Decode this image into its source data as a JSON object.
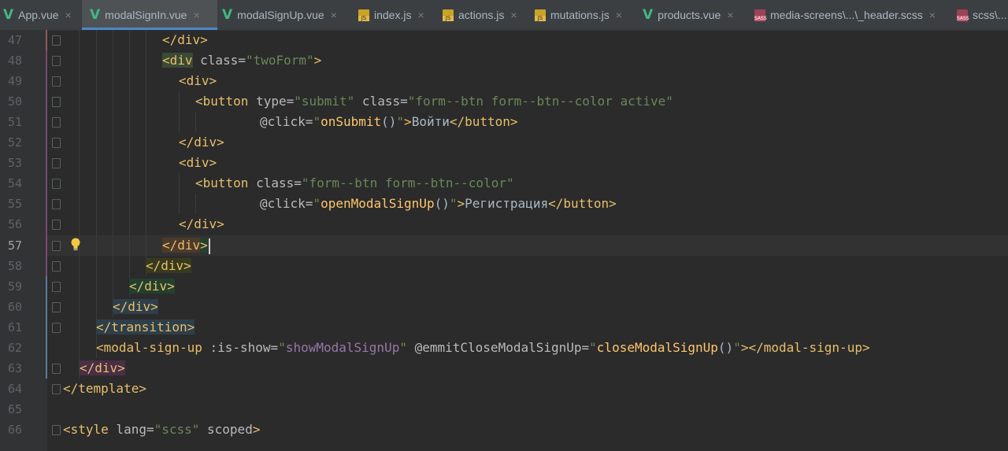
{
  "tabs": [
    {
      "label": "App.vue",
      "icon": "vue-icon",
      "active": false
    },
    {
      "label": "modalSignIn.vue",
      "icon": "vue-icon",
      "active": true
    },
    {
      "label": "modalSignUp.vue",
      "icon": "vue-icon",
      "active": false
    },
    {
      "label": "index.js",
      "icon": "js-file-icon",
      "active": false
    },
    {
      "label": "actions.js",
      "icon": "js-file-icon",
      "active": false
    },
    {
      "label": "mutations.js",
      "icon": "js-file-icon",
      "active": false
    },
    {
      "label": "products.vue",
      "icon": "vue-icon",
      "active": false
    },
    {
      "label": "media-screens\\...\\_header.scss",
      "icon": "sass-file-icon",
      "active": false
    },
    {
      "label": "scss\\...",
      "icon": "sass-file-icon",
      "active": false
    }
  ],
  "icon_badges": {
    "js": "JS",
    "sass": "SASS"
  },
  "close_glyph": "×",
  "current_line": "57",
  "line_numbers": [
    "47",
    "48",
    "49",
    "50",
    "51",
    "52",
    "53",
    "54",
    "55",
    "56",
    "57",
    "58",
    "59",
    "60",
    "61",
    "62",
    "63",
    "64",
    "65",
    "66"
  ],
  "code": {
    "l47": {
      "t1": "</div>"
    },
    "l48": {
      "t1": "<div",
      "a1": " class=",
      "s1": "\"twoForm\"",
      "t2": ">"
    },
    "l49": {
      "t1": "<div>"
    },
    "l50": {
      "t1": "<button",
      "a1": " type=",
      "s1": "\"submit\"",
      "a2": " class=",
      "s2": "\"form--btn form--btn--color active\""
    },
    "l51": {
      "a1": "@click=",
      "q1": "\"",
      "f1": "onSubmit",
      "p1": "()",
      "q2": "\"",
      "t1": ">",
      "x1": "Войти",
      "t2": "</button>"
    },
    "l52": {
      "t1": "</div>"
    },
    "l53": {
      "t1": "<div>"
    },
    "l54": {
      "t1": "<button",
      "a1": " class=",
      "s1": "\"form--btn form--btn--color\""
    },
    "l55": {
      "a1": "@click=",
      "q1": "\"",
      "f1": "openModalSignUp",
      "p1": "()",
      "q2": "\"",
      "t1": ">",
      "x1": "Регистрация",
      "t2": "</button>"
    },
    "l56": {
      "t1": "</div>"
    },
    "l57": {
      "t1": "</div",
      "t2": ">"
    },
    "l58": {
      "t1": "</div>"
    },
    "l59": {
      "t1": "</div>"
    },
    "l60": {
      "t1": "</div>"
    },
    "l61": {
      "t1": "</transition>"
    },
    "l62": {
      "t1": "<modal-sign-up",
      "a1": " :is-show=",
      "q1": "\"",
      "v1": "showModalSignUp",
      "q2": "\"",
      "a2": " @emmitCloseModalSignUp=",
      "q3": "\"",
      "f1": "closeModalSignUp",
      "p1": "()",
      "q4": "\"",
      "t2": "></modal-sign-up>"
    },
    "l63": {
      "t1": "</div>"
    },
    "l64": {
      "t1": "</template>"
    },
    "l65": {},
    "l66": {
      "t1": "<style",
      "a1": " lang=",
      "s1": "\"scss\"",
      "a2": " scoped",
      "t2": ">"
    }
  }
}
